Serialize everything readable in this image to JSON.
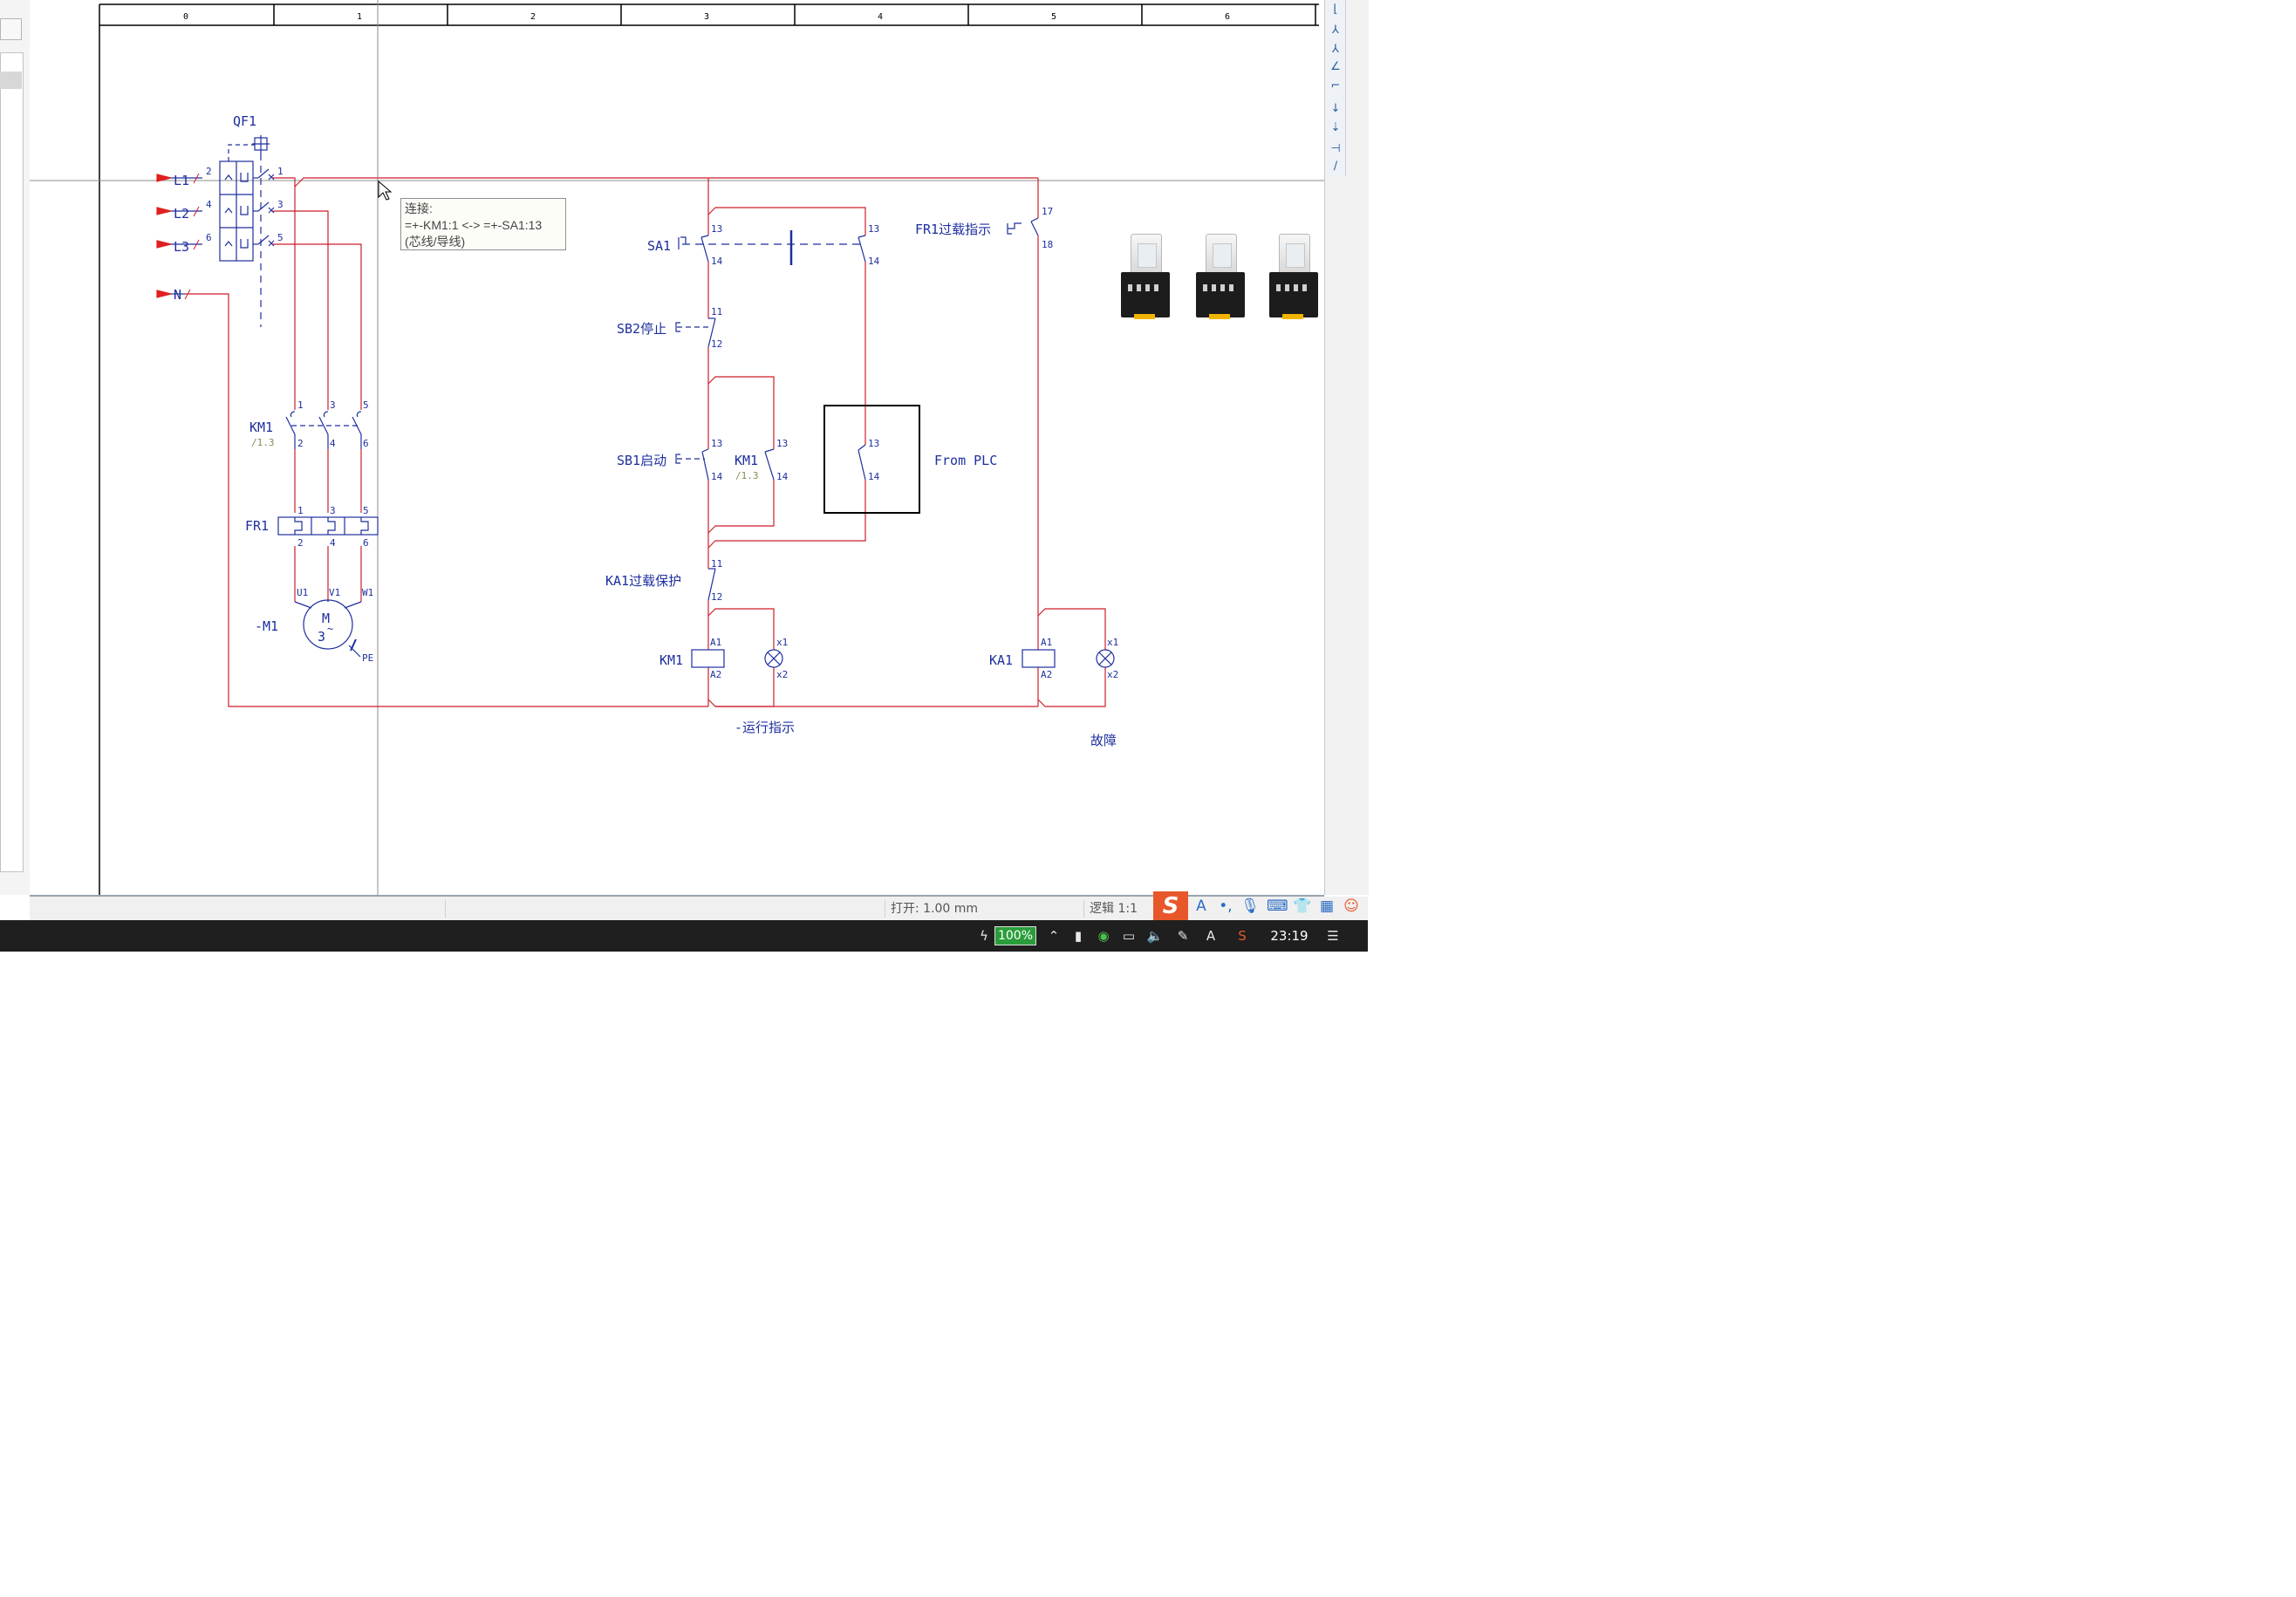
{
  "drawing": {
    "column_numbers": [
      "0",
      "1",
      "2",
      "3",
      "4",
      "5",
      "6"
    ],
    "qf1": {
      "label": "QF1",
      "pin_in": [
        "2",
        "4",
        "6"
      ],
      "pin_out": [
        "1",
        "3",
        "5"
      ]
    },
    "phases": [
      "L1",
      "L2",
      "L3",
      "N"
    ],
    "km1_main": {
      "label": "KM1",
      "ref": "/1.3",
      "top_pins": [
        "1",
        "3",
        "5"
      ],
      "bottom_pins": [
        "2",
        "4",
        "6"
      ]
    },
    "fr1": {
      "label": "FR1",
      "top_pins": [
        "1",
        "3",
        "5"
      ],
      "bottom_pins": [
        "2",
        "4",
        "6"
      ]
    },
    "motor": {
      "label": "-M1",
      "symbol_top": "M",
      "symbol_bottom": "3",
      "tilde": "~",
      "terminals": [
        "U1",
        "V1",
        "W1"
      ],
      "pe": "PE"
    },
    "sa1": {
      "label": "SA1",
      "pins": [
        "13",
        "14",
        "13",
        "14"
      ]
    },
    "sb2": {
      "label": "SB2停止",
      "pins": [
        "11",
        "12"
      ]
    },
    "sb1": {
      "label": "SB1启动",
      "pins": [
        "13",
        "14"
      ]
    },
    "km1_aux": {
      "label": "KM1",
      "ref": "/1.3",
      "pins": [
        "13",
        "14"
      ]
    },
    "plc_box": {
      "label": "From PLC",
      "pins": [
        "13",
        "14"
      ]
    },
    "ka1_contact": {
      "label": "KA1过载保护",
      "pins": [
        "11",
        "12"
      ]
    },
    "km1_coil": {
      "label": "KM1",
      "pins": [
        "A1",
        "A2"
      ]
    },
    "km1_lamp": {
      "label": "-运行指示",
      "pins": [
        "x1",
        "x2"
      ]
    },
    "fr1_contact": {
      "label": "FR1过载指示",
      "pins": [
        "17",
        "18"
      ]
    },
    "ka1_coil": {
      "label": "KA1",
      "pins": [
        "A1",
        "A2"
      ]
    },
    "ka1_lamp": {
      "label": "故障",
      "pins": [
        "x1",
        "x2"
      ]
    }
  },
  "tooltip": {
    "line1": "连接:",
    "line2": "=+-KM1:1 <-> =+-SA1:13",
    "line3": "(芯线/导线)"
  },
  "status_bar": {
    "open_value": "打开: 1.00 mm",
    "logic_value": "逻辑 1:1"
  },
  "taskbar": {
    "battery": "100%",
    "time": "23:19"
  },
  "icons": [
    "selection-field-icon",
    "wire-tool-icon",
    "t-junction-icon",
    "corner-icon",
    "angle-icon",
    "arrow-down-icon",
    "ime-logo-icon",
    "ime-text-icon",
    "ime-punct-icon",
    "microphone-icon",
    "keyboard-icon",
    "skin-icon",
    "grid-icon",
    "battery-icon",
    "wechat-icon",
    "volume-icon",
    "notification-icon"
  ],
  "colors": {
    "wire": "#cd1f2b",
    "symbol": "#1e2f9e",
    "grid": "#000000",
    "ref": "#8a8a5a"
  }
}
